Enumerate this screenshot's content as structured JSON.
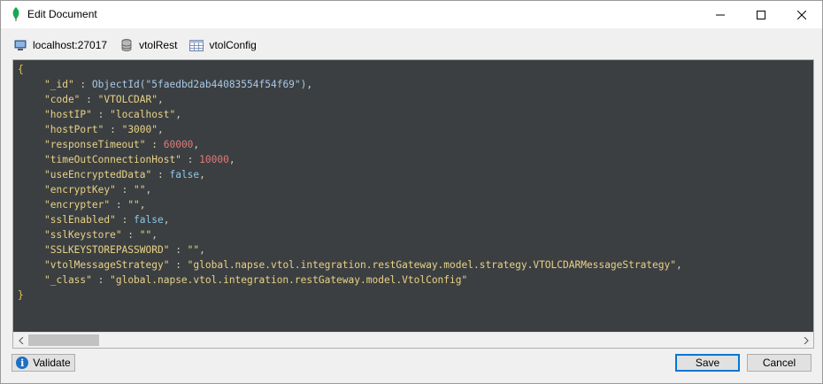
{
  "window": {
    "title": "Edit Document"
  },
  "breadcrumb": {
    "server": "localhost:27017",
    "database": "vtolRest",
    "collection": "vtolConfig"
  },
  "document": {
    "open_brace": "{",
    "close_brace": "}",
    "fields": [
      {
        "key": "\"_id\"",
        "sep": " : ",
        "value": "ObjectId(\"5faedbd2ab44083554f54f69\")",
        "type": "objectid",
        "trail": ","
      },
      {
        "key": "\"code\"",
        "sep": " : ",
        "value": "\"VTOLCDAR\"",
        "type": "string",
        "trail": ","
      },
      {
        "key": "\"hostIP\"",
        "sep": " : ",
        "value": "\"localhost\"",
        "type": "string",
        "trail": ","
      },
      {
        "key": "\"hostPort\"",
        "sep": " : ",
        "value": "\"3000\"",
        "type": "string",
        "trail": ","
      },
      {
        "key": "\"responseTimeout\"",
        "sep": " : ",
        "value": "60000",
        "type": "number",
        "trail": ","
      },
      {
        "key": "\"timeOutConnectionHost\"",
        "sep": " : ",
        "value": "10000",
        "type": "number",
        "trail": ","
      },
      {
        "key": "\"useEncryptedData\"",
        "sep": " : ",
        "value": "false",
        "type": "bool",
        "trail": ","
      },
      {
        "key": "\"encryptKey\"",
        "sep": " : ",
        "value": "\"\"",
        "type": "string",
        "trail": ","
      },
      {
        "key": "\"encrypter\"",
        "sep": " : ",
        "value": "\"\"",
        "type": "string",
        "trail": ","
      },
      {
        "key": "\"sslEnabled\"",
        "sep": " : ",
        "value": "false",
        "type": "bool",
        "trail": ","
      },
      {
        "key": "\"sslKeystore\"",
        "sep": " : ",
        "value": "\"\"",
        "type": "string",
        "trail": ","
      },
      {
        "key": "\"SSLKEYSTOREPASSWORD\"",
        "sep": " : ",
        "value": "\"\"",
        "type": "string",
        "trail": ","
      },
      {
        "key": "\"vtolMessageStrategy\"",
        "sep": " : ",
        "value": "\"global.napse.vtol.integration.restGateway.model.strategy.VTOLCDARMessageStrategy\"",
        "type": "string",
        "trail": ","
      },
      {
        "key": "\"_class\"",
        "sep": " : ",
        "value": "\"global.napse.vtol.integration.restGateway.model.VtolConfig\"",
        "type": "string",
        "trail": ""
      }
    ]
  },
  "buttons": {
    "validate": "Validate",
    "save": "Save",
    "cancel": "Cancel"
  },
  "icons": {
    "app": "leaf-icon",
    "server": "monitor-icon",
    "database": "database-icon",
    "collection": "table-icon",
    "validate": "info-icon"
  },
  "colors": {
    "editor_bg": "#3c3f41",
    "key": "#e8d287",
    "string": "#e8d287",
    "number": "#e07a7a",
    "bool": "#8ec6e8",
    "accent": "#0078d7"
  }
}
